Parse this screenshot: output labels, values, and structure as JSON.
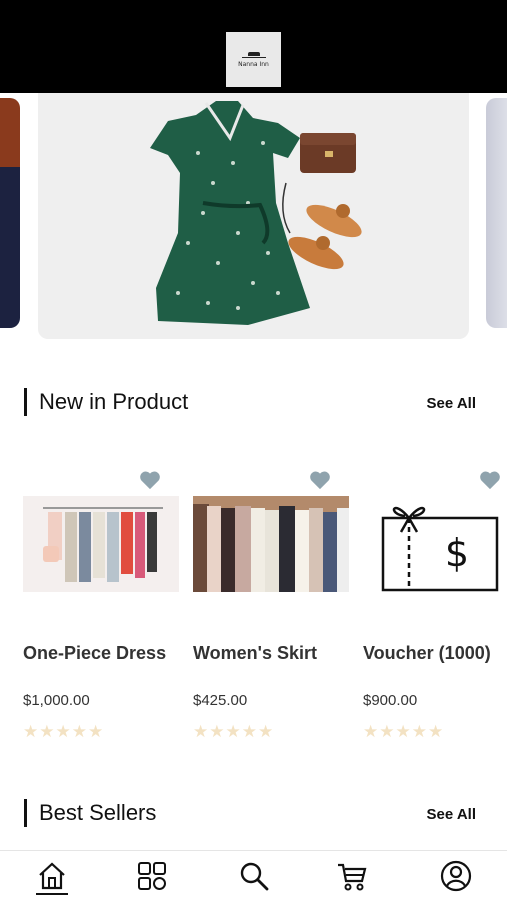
{
  "header": {
    "logo_text": "Nanna Inn"
  },
  "new_products": {
    "title": "New in Product",
    "see_all": "See All",
    "items": [
      {
        "name": "One-Piece Dress",
        "price": "$1,000.00",
        "rating": 0,
        "max_rating": 5
      },
      {
        "name": "Women's Skirt",
        "price": "$425.00",
        "rating": 0,
        "max_rating": 5
      },
      {
        "name": "Voucher (1000)",
        "price": "$900.00",
        "rating": 0,
        "max_rating": 5
      }
    ],
    "stars": "★★★★★"
  },
  "best_sellers": {
    "title": "Best Sellers",
    "see_all": "See All"
  },
  "nav": {
    "items": [
      "home-icon",
      "categories-icon",
      "search-icon",
      "cart-icon",
      "profile-icon"
    ],
    "active": "home-icon"
  },
  "colors": {
    "header_bg": "#000000",
    "heart": "#8fa3ad",
    "star_empty": "#f3e2c3"
  }
}
